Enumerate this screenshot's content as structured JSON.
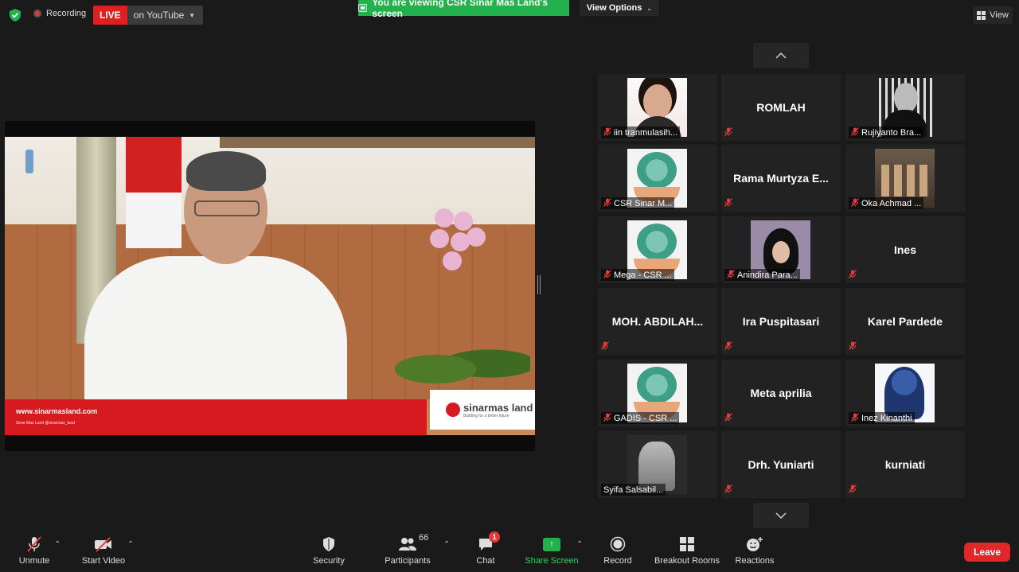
{
  "top": {
    "recording_label": "Recording",
    "live_label": "LIVE",
    "live_target": "on YouTube",
    "viewing_banner": "You are viewing CSR Sinar Mas Land's screen",
    "view_options": "View Options",
    "view_button": "View"
  },
  "shared_video": {
    "website": "www.sinarmasland.com",
    "social": "Sinar Mas Land   @sinarmas_land",
    "logo_name": "sinarmas land",
    "logo_tagline": "Building for a better future"
  },
  "participants": [
    {
      "name": "iin tranmulasih...",
      "avatar": "photo-woman",
      "muted": true
    },
    {
      "name": "ROMLAH",
      "avatar": "none",
      "muted": true
    },
    {
      "name": "Rujiyanto Bra...",
      "avatar": "photo-man",
      "muted": true
    },
    {
      "name": "CSR Sinar M...",
      "avatar": "csr-logo",
      "muted": true
    },
    {
      "name": "Rama  Murtyza  E...",
      "avatar": "none",
      "muted": true
    },
    {
      "name": "Oka Achmad ...",
      "avatar": "photo-group",
      "muted": true
    },
    {
      "name": "Mega - CSR ...",
      "avatar": "csr-logo",
      "muted": true
    },
    {
      "name": "Anindira Para...",
      "avatar": "photo-hijab",
      "muted": true
    },
    {
      "name": "Ines",
      "avatar": "none",
      "muted": true
    },
    {
      "name": "MOH.  ABDILAH...",
      "avatar": "none",
      "muted": true
    },
    {
      "name": "Ira Puspitasari",
      "avatar": "none",
      "muted": true
    },
    {
      "name": "Karel Pardede",
      "avatar": "none",
      "muted": true
    },
    {
      "name": "GADIS - CSR ...",
      "avatar": "csr-logo",
      "muted": true
    },
    {
      "name": "Meta aprilia",
      "avatar": "none",
      "muted": true
    },
    {
      "name": "Inez Kinanthi",
      "avatar": "art-portrait",
      "muted": true
    },
    {
      "name": "Syifa Salsabil...",
      "avatar": "sketch",
      "muted": false
    },
    {
      "name": "Drh. Yuniarti",
      "avatar": "none",
      "muted": true
    },
    {
      "name": "kurniati",
      "avatar": "none",
      "muted": true
    }
  ],
  "toolbar": {
    "unmute": "Unmute",
    "start_video": "Start Video",
    "security": "Security",
    "participants": "Participants",
    "participants_count": "66",
    "chat": "Chat",
    "chat_badge": "1",
    "share_screen": "Share Screen",
    "record": "Record",
    "breakout_rooms": "Breakout Rooms",
    "reactions": "Reactions",
    "leave": "Leave"
  },
  "colors": {
    "background": "#1a1a1a",
    "live_red": "#e02020",
    "share_green": "#22b14c",
    "leave_red": "#e02828",
    "muted_mic": "#e83b3b"
  }
}
